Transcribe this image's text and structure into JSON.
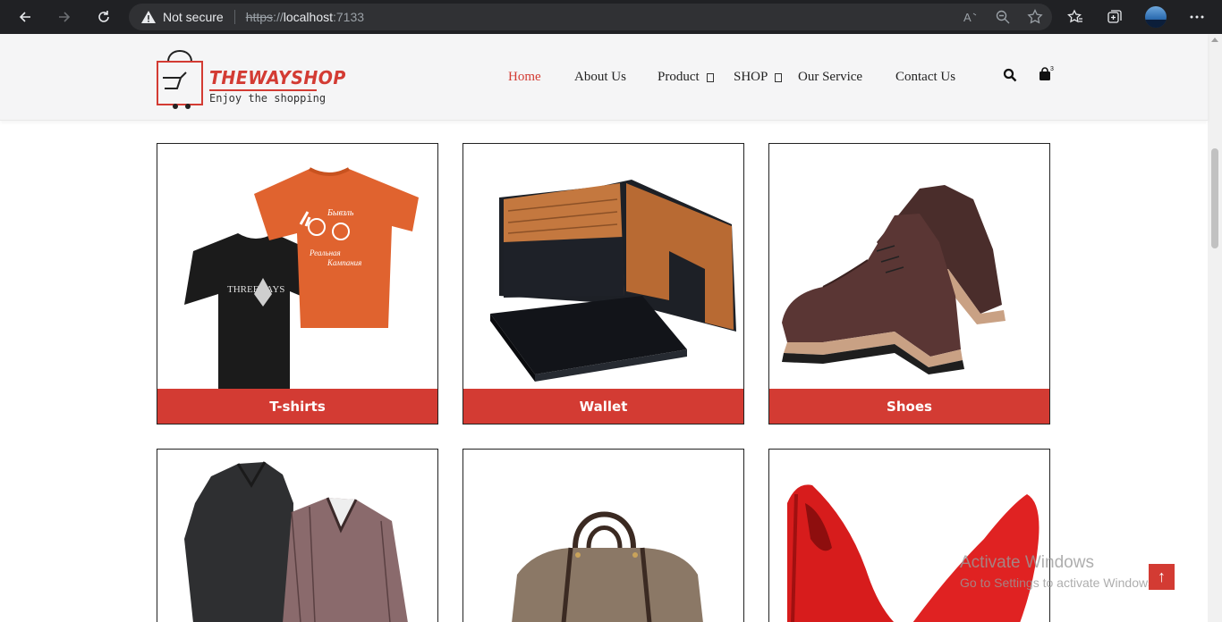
{
  "browser": {
    "security_label": "Not secure",
    "url_scheme": "https",
    "url_sep": "://",
    "url_host": "localhost",
    "url_port": ":7133"
  },
  "site": {
    "logo_title": "THEWAYSHOP",
    "logo_tagline": "Enjoy the shopping",
    "menu": [
      {
        "label": "Home",
        "active": true
      },
      {
        "label": "About Us"
      },
      {
        "label": "Product",
        "dropdown": true
      },
      {
        "label": "SHOP",
        "dropdown": true
      },
      {
        "label": "Our Service"
      },
      {
        "label": "Contact Us"
      }
    ],
    "cart_count": "3",
    "accent_color": "#d33b33"
  },
  "products": [
    {
      "label": "T-shirts"
    },
    {
      "label": "Wallet"
    },
    {
      "label": "Shoes"
    },
    {
      "label": ""
    },
    {
      "label": ""
    },
    {
      "label": ""
    }
  ],
  "watermark": {
    "line1": "Activate Windows",
    "line2": "Go to Settings to activate Windows."
  },
  "back_to_top": "↑"
}
